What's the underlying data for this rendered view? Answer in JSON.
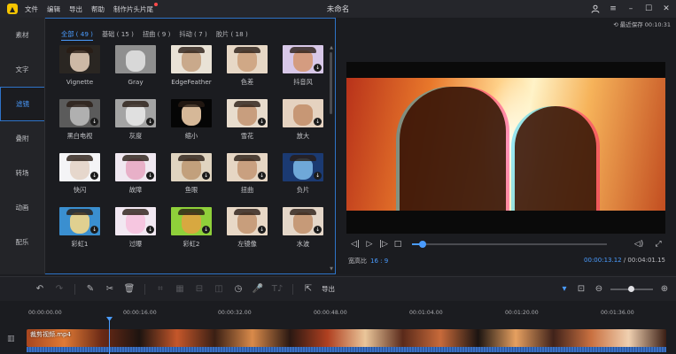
{
  "window": {
    "title": "未命名",
    "autosave": "最近保存 00:10:31"
  },
  "menu": {
    "items": [
      "文件",
      "编辑",
      "导出",
      "帮助",
      "制作片头片尾"
    ]
  },
  "sidebar": {
    "items": [
      "素材",
      "文字",
      "滤镜",
      "叠附",
      "转场",
      "动画",
      "配乐"
    ],
    "active_index": 2
  },
  "filters": {
    "categories": [
      "全部 ( 49 )",
      "基础 ( 15 )",
      "扭曲 ( 9 )",
      "抖动 ( 7 )",
      "胶片 ( 18 )"
    ],
    "active_category": 0,
    "items": [
      {
        "label": "Vignette",
        "bg": "#2a2622",
        "dog": "#cdb9a6",
        "hat": true,
        "download": false
      },
      {
        "label": "Gray",
        "bg": "#8f8f8f",
        "dog": "#d8d8d8",
        "hat": false,
        "download": false
      },
      {
        "label": "EdgeFeather",
        "bg": "#e9e2d6",
        "dog": "#c9a98b",
        "hat": true,
        "download": false
      },
      {
        "label": "色差",
        "bg": "#e7d8c6",
        "dog": "#d0a886",
        "hat": true,
        "download": false
      },
      {
        "label": "抖音风",
        "bg": "#d8c8e8",
        "dog": "#d49c80",
        "hat": true,
        "download": true
      },
      {
        "label": "黑白电视",
        "bg": "#5b5b5b",
        "dog": "#b0b0b0",
        "hat": true,
        "download": true
      },
      {
        "label": "灰度",
        "bg": "#a4a4a4",
        "dog": "#e0e0e0",
        "hat": true,
        "download": true
      },
      {
        "label": "缩小",
        "bg": "#050505",
        "dog": "#d6b898",
        "hat": true,
        "download": false
      },
      {
        "label": "雪花",
        "bg": "#e8dccd",
        "dog": "#c89e7e",
        "hat": true,
        "download": true
      },
      {
        "label": "放大",
        "bg": "#e5d2c0",
        "dog": "#c79775",
        "hat": false,
        "download": true
      },
      {
        "label": "快闪",
        "bg": "#f4f4f6",
        "dog": "#e6d7cc",
        "hat": true,
        "download": true
      },
      {
        "label": "故障",
        "bg": "#f0e8f0",
        "dog": "#e8b0c8",
        "hat": true,
        "download": true
      },
      {
        "label": "鱼眼",
        "bg": "#e0d4c0",
        "dog": "#c2a07c",
        "hat": true,
        "download": true
      },
      {
        "label": "扭曲",
        "bg": "#e6d6c4",
        "dog": "#c9a080",
        "hat": true,
        "download": true
      },
      {
        "label": "负片",
        "bg": "#1b3a72",
        "dog": "#6fa8d8",
        "hat": true,
        "download": true
      },
      {
        "label": "彩虹1",
        "bg": "#3a8fd0",
        "dog": "#e0d090",
        "hat": true,
        "download": true
      },
      {
        "label": "过曝",
        "bg": "#f2e8f2",
        "dog": "#f6c6e0",
        "hat": true,
        "download": true
      },
      {
        "label": "彩虹2",
        "bg": "#8fd03a",
        "dog": "#d8a840",
        "hat": true,
        "download": true
      },
      {
        "label": "左镜像",
        "bg": "#e8d8c6",
        "dog": "#c89e7c",
        "hat": true,
        "download": true
      },
      {
        "label": "水波",
        "bg": "#e4d6c8",
        "dog": "#c69a78",
        "hat": true,
        "download": true
      }
    ]
  },
  "preview": {
    "aspect_label": "宽高比",
    "aspect_value": "16 : 9",
    "current_time": "00:00:13.12",
    "total_time": "00:04:01.15",
    "progress": 0.054
  },
  "toolbar": {
    "export_label": "导出"
  },
  "timeline": {
    "ticks": [
      "00:00:00.00",
      "00:00:16.00",
      "00:00:32.00",
      "00:00:48.00",
      "00:01:04.00",
      "00:01:20.00",
      "00:01:36.00"
    ],
    "clip_label": "裁剪视频.mp4"
  },
  "colors": {
    "accent": "#4a9cff",
    "panel_border": "#2e73c8"
  }
}
